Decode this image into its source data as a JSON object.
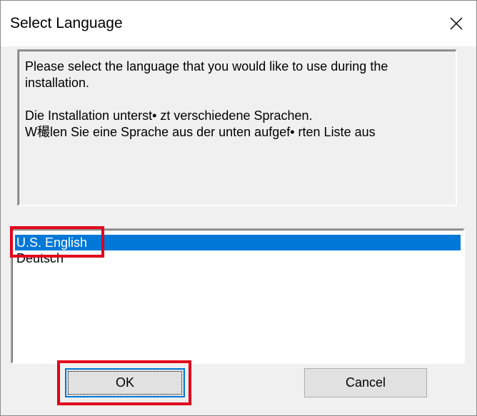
{
  "window": {
    "title": "Select Language",
    "close_icon": "close-icon"
  },
  "message": {
    "line1": "Please select the language that you would like to use during the installation.",
    "line2": "Die Installation unterst• zt verschiedene Sprachen.",
    "line3": "W穝len Sie eine Sprache aus der unten aufgef• rten Liste aus"
  },
  "languages": {
    "items": [
      {
        "label": "U.S. English",
        "selected": true
      },
      {
        "label": "Deutsch",
        "selected": false
      }
    ]
  },
  "buttons": {
    "ok_label": "OK",
    "cancel_label": "Cancel"
  },
  "colors": {
    "selection": "#0078d7",
    "highlight_annotation": "#e0001b"
  }
}
